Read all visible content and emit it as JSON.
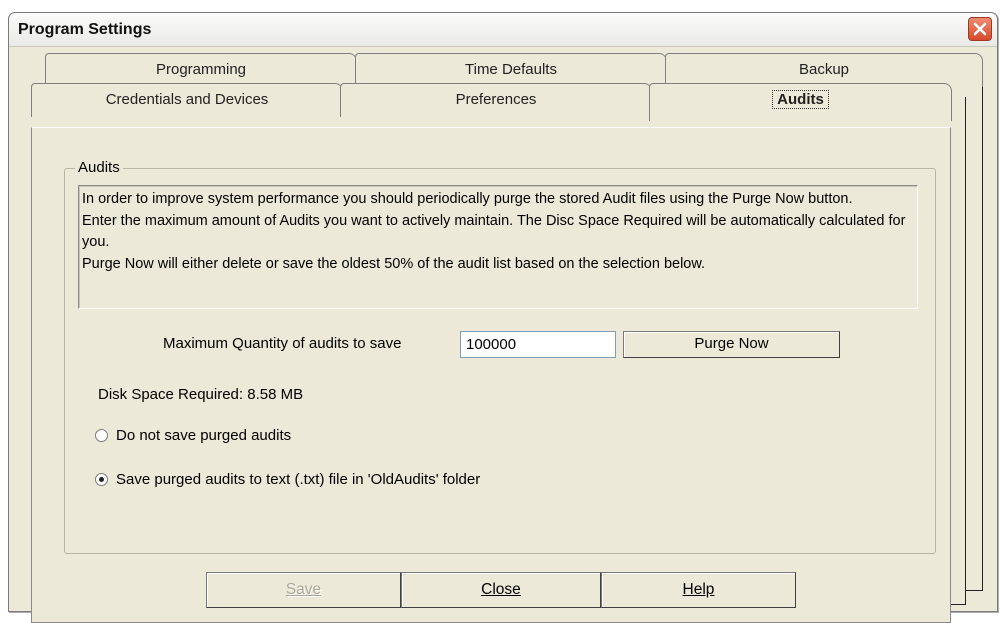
{
  "window": {
    "title": "Program Settings",
    "close_icon": "close-icon"
  },
  "tabs_row1": [
    {
      "label": "Programming"
    },
    {
      "label": "Time Defaults"
    },
    {
      "label": "Backup"
    }
  ],
  "tabs_row2": [
    {
      "label": "Credentials and Devices"
    },
    {
      "label": "Preferences"
    },
    {
      "label": "Audits",
      "active": true
    }
  ],
  "audits": {
    "group_title": "Audits",
    "info_text": "In order to improve system performance you should periodically purge the stored Audit files using the Purge Now button.\nEnter the maximum amount of Audits you want to actively  maintain.  The Disc Space Required will be automatically calculated for you.\nPurge Now will either delete or save the oldest 50% of the audit list based on the selection below.",
    "max_qty_label": "Maximum Quantity of audits to save",
    "max_qty_value": "100000",
    "purge_button": "Purge Now",
    "disk_space": "Disk Space Required: 8.58 MB",
    "radio_options": [
      {
        "label": "Do not save purged audits",
        "selected": false
      },
      {
        "label": "Save purged audits to text (.txt) file in 'OldAudits' folder",
        "selected": true
      }
    ]
  },
  "buttons": {
    "save": "Save",
    "close": "Close",
    "help": "Help"
  },
  "colors": {
    "window_bg": "#ece9d8",
    "close_button": "#d6492b"
  }
}
